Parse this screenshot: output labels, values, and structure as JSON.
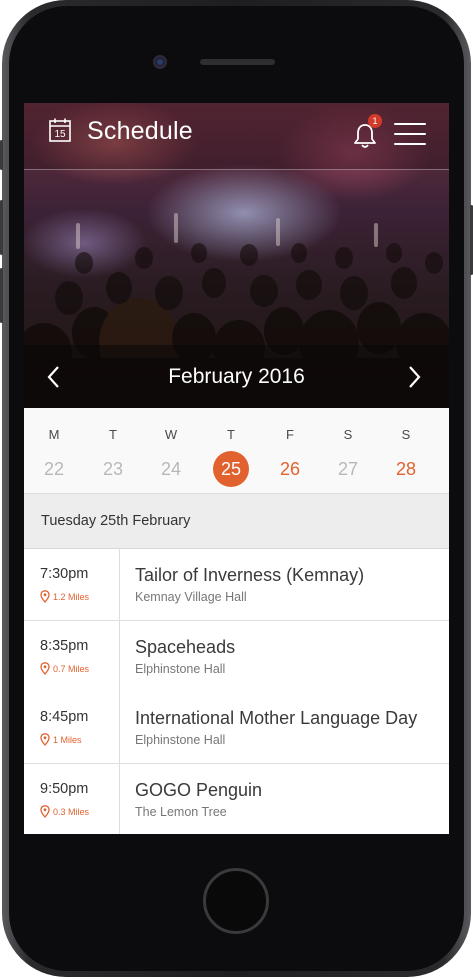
{
  "header": {
    "title": "Schedule",
    "calendar_icon_day": "15",
    "notification_count": "1"
  },
  "month": {
    "label": "February 2016"
  },
  "week": {
    "days": [
      {
        "name": "M",
        "num": "22",
        "state": "past"
      },
      {
        "name": "T",
        "num": "23",
        "state": "past"
      },
      {
        "name": "W",
        "num": "24",
        "state": "past"
      },
      {
        "name": "T",
        "num": "25",
        "state": "selected"
      },
      {
        "name": "F",
        "num": "26",
        "state": "event"
      },
      {
        "name": "S",
        "num": "27",
        "state": "past"
      },
      {
        "name": "S",
        "num": "28",
        "state": "event"
      }
    ]
  },
  "selected_date": "Tuesday 25th February",
  "events": [
    {
      "time": "7:30pm",
      "distance": "1.2 Miles",
      "name": "Tailor of Inverness (Kemnay)",
      "venue": "Kemnay Village Hall"
    },
    {
      "time": "8:35pm",
      "distance": "0.7 Miles",
      "name": "Spaceheads",
      "venue": "Elphinstone Hall"
    },
    {
      "time": "8:45pm",
      "distance": "1 Miles",
      "name": "International Mother Language Day",
      "venue": "Elphinstone Hall"
    },
    {
      "time": "9:50pm",
      "distance": "0.3 Miles",
      "name": "GOGO Penguin",
      "venue": "The Lemon Tree"
    }
  ],
  "colors": {
    "accent": "#e2622f",
    "badge": "#d43a2a"
  },
  "icons": [
    "calendar-icon",
    "bell-icon",
    "hamburger-menu-icon",
    "chevron-left-icon",
    "chevron-right-icon",
    "location-pin-icon"
  ]
}
